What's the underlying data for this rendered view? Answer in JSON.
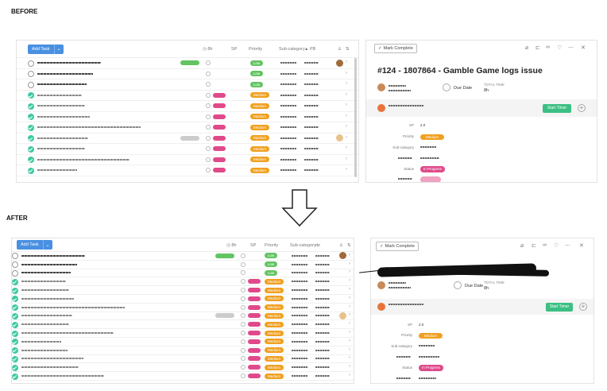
{
  "labels": {
    "before": "BEFORE",
    "after": "AFTER"
  },
  "before": {
    "list": {
      "add_task": "Add Task",
      "add_dropdown": "⌄",
      "hours": "8h",
      "col_sp": "SP",
      "col_priority": "Priority",
      "col_subcategory": "Sub-category",
      "col_extra": "▲ PB",
      "rows": [
        {
          "done": false,
          "p": "Low"
        },
        {
          "done": false,
          "p": "Low"
        },
        {
          "done": false,
          "p": "Low"
        },
        {
          "done": true,
          "p": "Medium"
        },
        {
          "done": true,
          "p": "Medium"
        },
        {
          "done": true,
          "p": "Medium"
        },
        {
          "done": true,
          "p": "Medium"
        },
        {
          "done": true,
          "p": "Medium"
        },
        {
          "done": true,
          "p": "Medium"
        },
        {
          "done": true,
          "p": "Medium"
        },
        {
          "done": true,
          "p": "Medium"
        }
      ]
    },
    "detail": {
      "mark_complete": "Mark Complete",
      "title": "#124 - 1807864 - Gamble Game logs issue",
      "due_date": "Due Date",
      "total_time_label": "TOTAL TIME",
      "total_time": "8h",
      "start_timer": "Start Timer",
      "fields": {
        "sp_label": "SP",
        "sp_value": "2.0",
        "priority_label": "Priority",
        "priority_value": "Medium",
        "subcategory_label": "Sub-category",
        "status_label": "Status",
        "status_value": "In Progress"
      }
    }
  },
  "after": {
    "list": {
      "add_task": "Add Task",
      "add_dropdown": "⌄",
      "hours": "8h",
      "col_sp": "SP",
      "col_priority": "Priority",
      "col_subcategory": "Sub-category",
      "col_extra": "de",
      "rows": [
        {
          "done": false,
          "p": "Low"
        },
        {
          "done": false,
          "p": "Low"
        },
        {
          "done": false,
          "p": "Low"
        },
        {
          "done": true,
          "p": "Medium"
        },
        {
          "done": true,
          "p": "Medium"
        },
        {
          "done": true,
          "p": "Medium"
        },
        {
          "done": true,
          "p": "Medium"
        },
        {
          "done": true,
          "p": "Medium"
        },
        {
          "done": true,
          "p": "Medium"
        },
        {
          "done": true,
          "p": "Medium"
        },
        {
          "done": true,
          "p": "Medium"
        },
        {
          "done": true,
          "p": "Medium"
        },
        {
          "done": true,
          "p": "Medium"
        },
        {
          "done": true,
          "p": "Medium"
        },
        {
          "done": true,
          "p": "Medium"
        }
      ]
    },
    "detail": {
      "mark_complete": "Mark Complete",
      "due_date": "Due Date",
      "total_time_label": "TOTAL TIME",
      "total_time": "8h",
      "start_timer": "Start Timer",
      "fields": {
        "sp_label": "SP",
        "sp_value": "2.0",
        "priority_label": "Priority",
        "priority_value": "Medium",
        "subcategory_label": "Sub-category",
        "status_label": "Status",
        "status_value": "In Progress"
      }
    }
  },
  "colors": {
    "accent": "#4a90e2",
    "done": "#3cc8a3",
    "low": "#62c462",
    "medium": "#f0a020",
    "status": "#e04a8a",
    "start": "#3cbf82"
  }
}
